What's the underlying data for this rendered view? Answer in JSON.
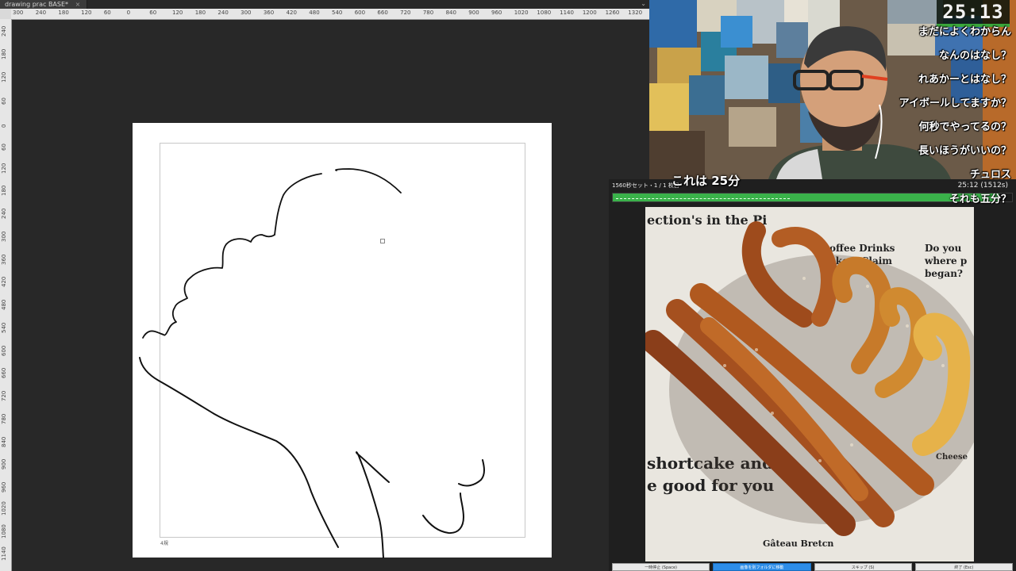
{
  "app": {
    "document_tab": "drawing prac BASE*",
    "tab_close_glyph": "×",
    "tabbar_chevron": "⌄",
    "ruler_top_labels": [
      "300",
      "240",
      "180",
      "120",
      "60",
      "0",
      "60",
      "120",
      "180",
      "240",
      "300",
      "360",
      "420",
      "480",
      "540",
      "600",
      "660",
      "720",
      "780",
      "840",
      "900",
      "960",
      "1020",
      "1080",
      "1140",
      "1200",
      "1260",
      "1320"
    ],
    "ruler_left_labels": [
      "240",
      "180",
      "120",
      "60",
      "0",
      "60",
      "120",
      "180",
      "240",
      "300",
      "360",
      "420",
      "480",
      "540",
      "600",
      "660",
      "720",
      "780",
      "840",
      "900",
      "960",
      "1020",
      "1080",
      "1140"
    ],
    "canvas_corner_label": "4規"
  },
  "stream": {
    "timer": "25:13",
    "comments": [
      "まだによくわからん",
      "なんのはなし？",
      "れあかーとはなし？",
      "アイボールしてますか？",
      "何秒でやってるの？",
      "長いほうがいいの？",
      "チュロス",
      "それも五分？"
    ],
    "caption": "これは 25分"
  },
  "viewer": {
    "set_label": "1560秒セット・1 / 1 枚目",
    "time_label": "25:12 (1512s)",
    "progress_fraction": 0.969,
    "buttons": [
      "一時停止 (Space)",
      "画像を別フォルダに移動",
      "スキップ (S)",
      "終了 (Esc)"
    ],
    "primary_button_index": 1,
    "image_texts": {
      "headline1": "shortcake and",
      "headline2": "e good for you",
      "coffee": "offee Drinks",
      "claim": "ake a Claim",
      "top": "ection's in the Pi",
      "q1": "Do you",
      "q2": "where p",
      "q3": "began?",
      "cheese": "Cheese",
      "gateau": "Gâteau Bretcn"
    }
  },
  "colors": {
    "accent_green": "#3ab24a",
    "button_blue": "#2d8de8"
  }
}
